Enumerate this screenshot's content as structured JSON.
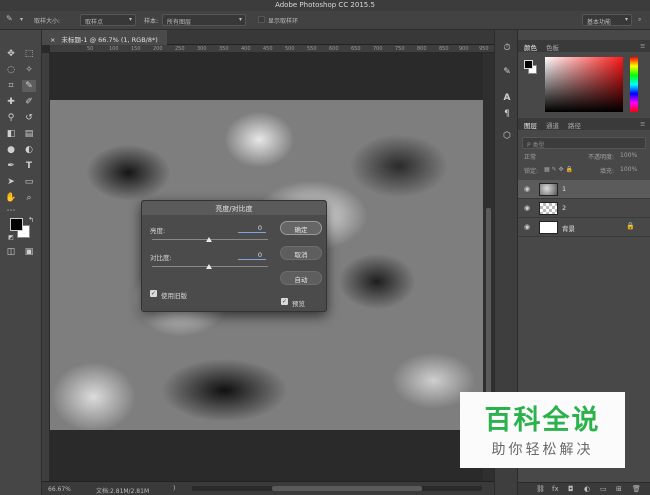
{
  "app": {
    "title": "Adobe Photoshop CC 2015.5"
  },
  "options_bar": {
    "sample_size_label": "取样大小:",
    "sample_size_value": "取样点",
    "sample_label": "样本:",
    "sample_value": "所有图层",
    "show_ring_label": "显示取样环",
    "workspace": "基本功能"
  },
  "document": {
    "tab_title": "未标题-1 @ 66.7% (1, RGB/8*) *",
    "ruler_numbers": [
      "50",
      "100",
      "150",
      "200",
      "250",
      "300",
      "350",
      "400",
      "450",
      "500",
      "550",
      "600",
      "650",
      "700",
      "750",
      "800",
      "850",
      "900",
      "950"
    ],
    "zoom": "66.67%",
    "doc_info": "文档:2.81M/2.81M",
    "more_arrow": ")"
  },
  "dialog": {
    "title": "亮度/对比度",
    "brightness_label": "亮度:",
    "brightness_value": "0",
    "contrast_label": "对比度:",
    "contrast_value": "0",
    "use_legacy_label": "使用旧版",
    "use_legacy_checked": true,
    "ok_label": "确定",
    "cancel_label": "取消",
    "auto_label": "自动",
    "preview_label": "预览",
    "preview_checked": true
  },
  "color_panel": {
    "tabs": [
      "颜色",
      "色板"
    ],
    "foreground": "#000000",
    "background": "#ffffff",
    "hue_color": "#ff1818"
  },
  "layers_panel": {
    "tabs": [
      "图层",
      "通道",
      "路径"
    ],
    "search_placeholder": "P 类型",
    "blend_mode": "正常",
    "opacity_label": "不透明度:",
    "opacity_value": "100%",
    "lock_label": "锁定:",
    "fill_label": "填充:",
    "fill_value": "100%",
    "layers": [
      {
        "name": "1",
        "selected": true,
        "thumb": "clouds"
      },
      {
        "name": "2",
        "selected": false,
        "thumb": "transparent"
      },
      {
        "name": "背景",
        "selected": false,
        "thumb": "white",
        "locked": true
      }
    ]
  },
  "watermark": {
    "title": "百科全说",
    "subtitle": "助你轻松解决"
  }
}
